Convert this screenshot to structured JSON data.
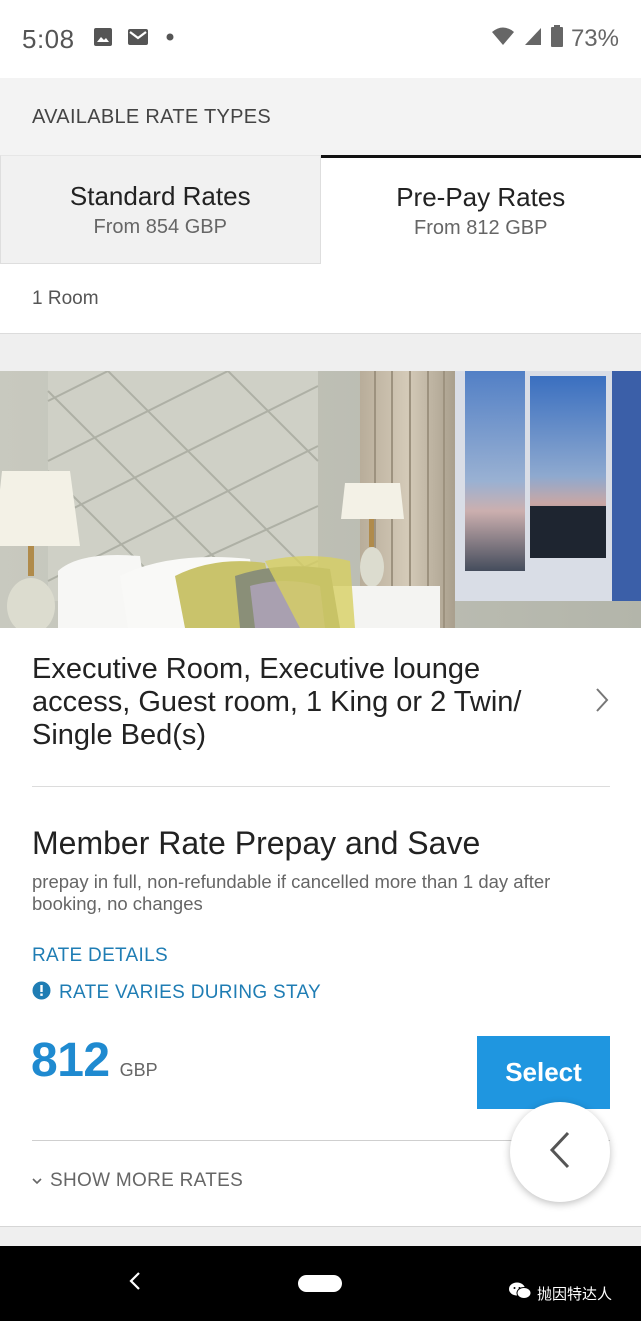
{
  "status_bar": {
    "time": "5:08",
    "battery": "73%",
    "icons": [
      "image-icon",
      "gmail-icon",
      "dot-icon",
      "wifi-icon",
      "signal-icon",
      "battery-icon"
    ]
  },
  "rate_types": {
    "header": "AVAILABLE RATE TYPES",
    "tabs": [
      {
        "title": "Standard Rates",
        "subtitle": "From 854 GBP",
        "active": false
      },
      {
        "title": "Pre-Pay Rates",
        "subtitle": "From 812 GBP",
        "active": true
      }
    ],
    "room_count": "1 Room"
  },
  "room": {
    "name": "Executive Room, Executive lounge access, Guest room, 1 King or 2 Twin/ Single Bed(s)",
    "rate_name": "Member Rate Prepay and Save",
    "rate_description": "prepay in full, non-refundable if cancelled more than 1 day after booking, no changes",
    "rate_details_link": "RATE DETAILS",
    "rate_varies": "RATE VARIES DURING STAY",
    "price": "812",
    "currency": "GBP",
    "select_label": "Select",
    "show_more": "SHOW MORE RATES"
  },
  "watermark": "抛因特达人",
  "colors": {
    "accent_blue": "#1f8ad0",
    "button_blue": "#1f96e0",
    "link_blue": "#1f7db4"
  }
}
